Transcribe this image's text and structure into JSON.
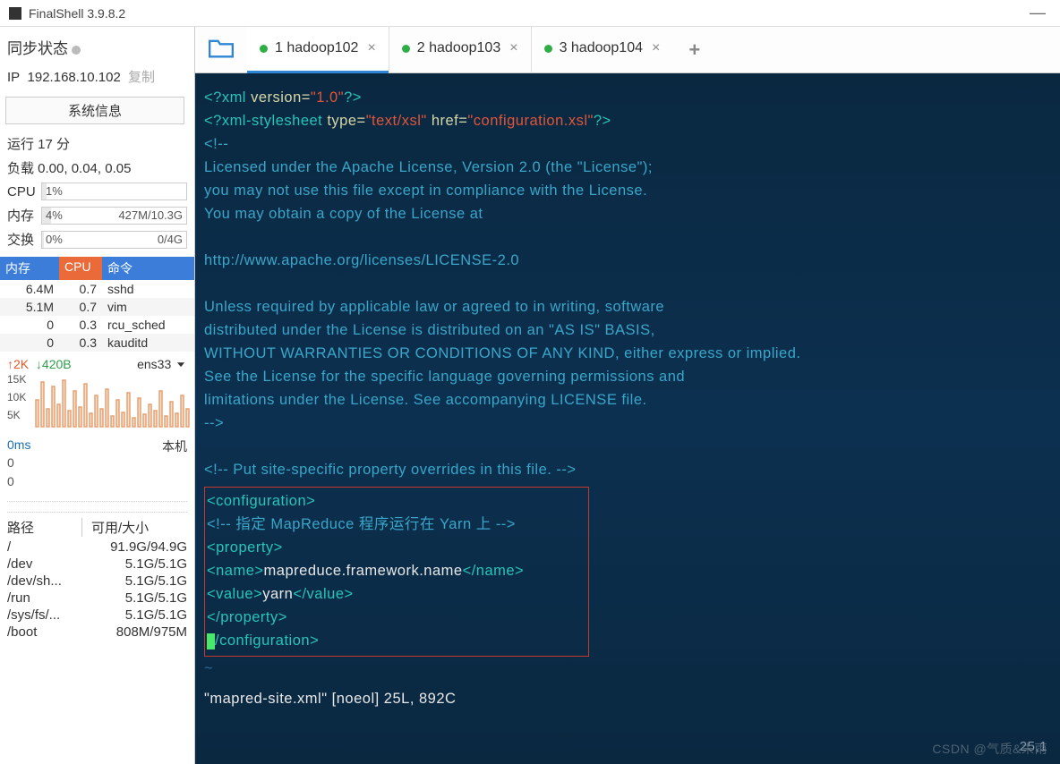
{
  "title": "FinalShell 3.9.8.2",
  "sync": {
    "label": "同步状态"
  },
  "ip": {
    "label": "IP",
    "value": "192.168.10.102",
    "copy": "复制"
  },
  "sysinfo_btn": "系统信息",
  "uptime": "运行 17 分",
  "load": "负载 0.00, 0.04, 0.05",
  "cpu": {
    "label": "CPU",
    "pct": "1%"
  },
  "mem": {
    "label": "内存",
    "pct": "4%",
    "detail": "427M/10.3G"
  },
  "swap": {
    "label": "交换",
    "pct": "0%",
    "detail": "0/4G"
  },
  "proc_head": {
    "c1": "内存",
    "c2": "CPU",
    "c3": "命令"
  },
  "procs": [
    {
      "m": "6.4M",
      "c": "0.7",
      "n": "sshd"
    },
    {
      "m": "5.1M",
      "c": "0.7",
      "n": "vim"
    },
    {
      "m": "0",
      "c": "0.3",
      "n": "rcu_sched"
    },
    {
      "m": "0",
      "c": "0.3",
      "n": "kauditd"
    }
  ],
  "net": {
    "up": "↑2K",
    "down": "↓420B",
    "iface": "ens33",
    "yticks": [
      "15K",
      "10K",
      "5K"
    ]
  },
  "lat": {
    "ms": "0ms",
    "host": "本机",
    "n1": "0",
    "n2": "0"
  },
  "path_head": {
    "c1": "路径",
    "c2": "可用/大小"
  },
  "paths": [
    {
      "p": "/",
      "s": "91.9G/94.9G"
    },
    {
      "p": "/dev",
      "s": "5.1G/5.1G"
    },
    {
      "p": "/dev/sh...",
      "s": "5.1G/5.1G"
    },
    {
      "p": "/run",
      "s": "5.1G/5.1G"
    },
    {
      "p": "/sys/fs/...",
      "s": "5.1G/5.1G"
    },
    {
      "p": "/boot",
      "s": "808M/975M"
    }
  ],
  "tabs": [
    {
      "n": "1 hadoop102",
      "active": true
    },
    {
      "n": "2 hadoop103",
      "active": false
    },
    {
      "n": "3 hadoop104",
      "active": false
    }
  ],
  "xml": {
    "decl_open": "<?",
    "decl_xml": "xml",
    "decl_ver": " version=",
    "decl_verval": "\"1.0\"",
    "decl_close": "?>",
    "style_open": "<?",
    "style_name": "xml-stylesheet",
    "style_type": " type=",
    "style_typeval": "\"text/xsl\"",
    "style_href": " href=",
    "style_hrefval": "\"configuration.xsl\"",
    "style_close": "?>",
    "c_open": "<!--",
    "lic1": "  Licensed under the Apache License, Version 2.0 (the \"License\");",
    "lic2": "  you may not use this file except in compliance with the License.",
    "lic3": "  You may obtain a copy of the License at",
    "lic4": "    http://www.apache.org/licenses/LICENSE-2.0",
    "lic5": "  Unless required by applicable law or agreed to in writing, software",
    "lic6": "  distributed under the License is distributed on an \"AS IS\" BASIS,",
    "lic7": "  WITHOUT WARRANTIES OR CONDITIONS OF ANY KIND, either express or implied.",
    "lic8": "  See the License for the specific language governing permissions and",
    "lic9": "  limitations under the License. See accompanying LICENSE file.",
    "c_close": "-->",
    "c2": "<!-- Put site-specific property overrides in this file. -->",
    "conf_open": "<configuration>",
    "c3": "<!-- 指定 MapReduce 程序运行在 Yarn 上 -->",
    "prop_open": " <property>",
    "name_open": "  <name>",
    "name_val": "mapreduce.framework.name",
    "name_close": "</name>",
    "val_open": "  <value>",
    "val_val": "yarn",
    "val_close": "</value>",
    "prop_close": " </property>",
    "conf_close": "/configuration>",
    "tilde": "~",
    "status": "\"mapred-site.xml\" [noeol] 25L, 892C",
    "pos": "25,1"
  },
  "watermark": "CSDN @气质&末雨"
}
